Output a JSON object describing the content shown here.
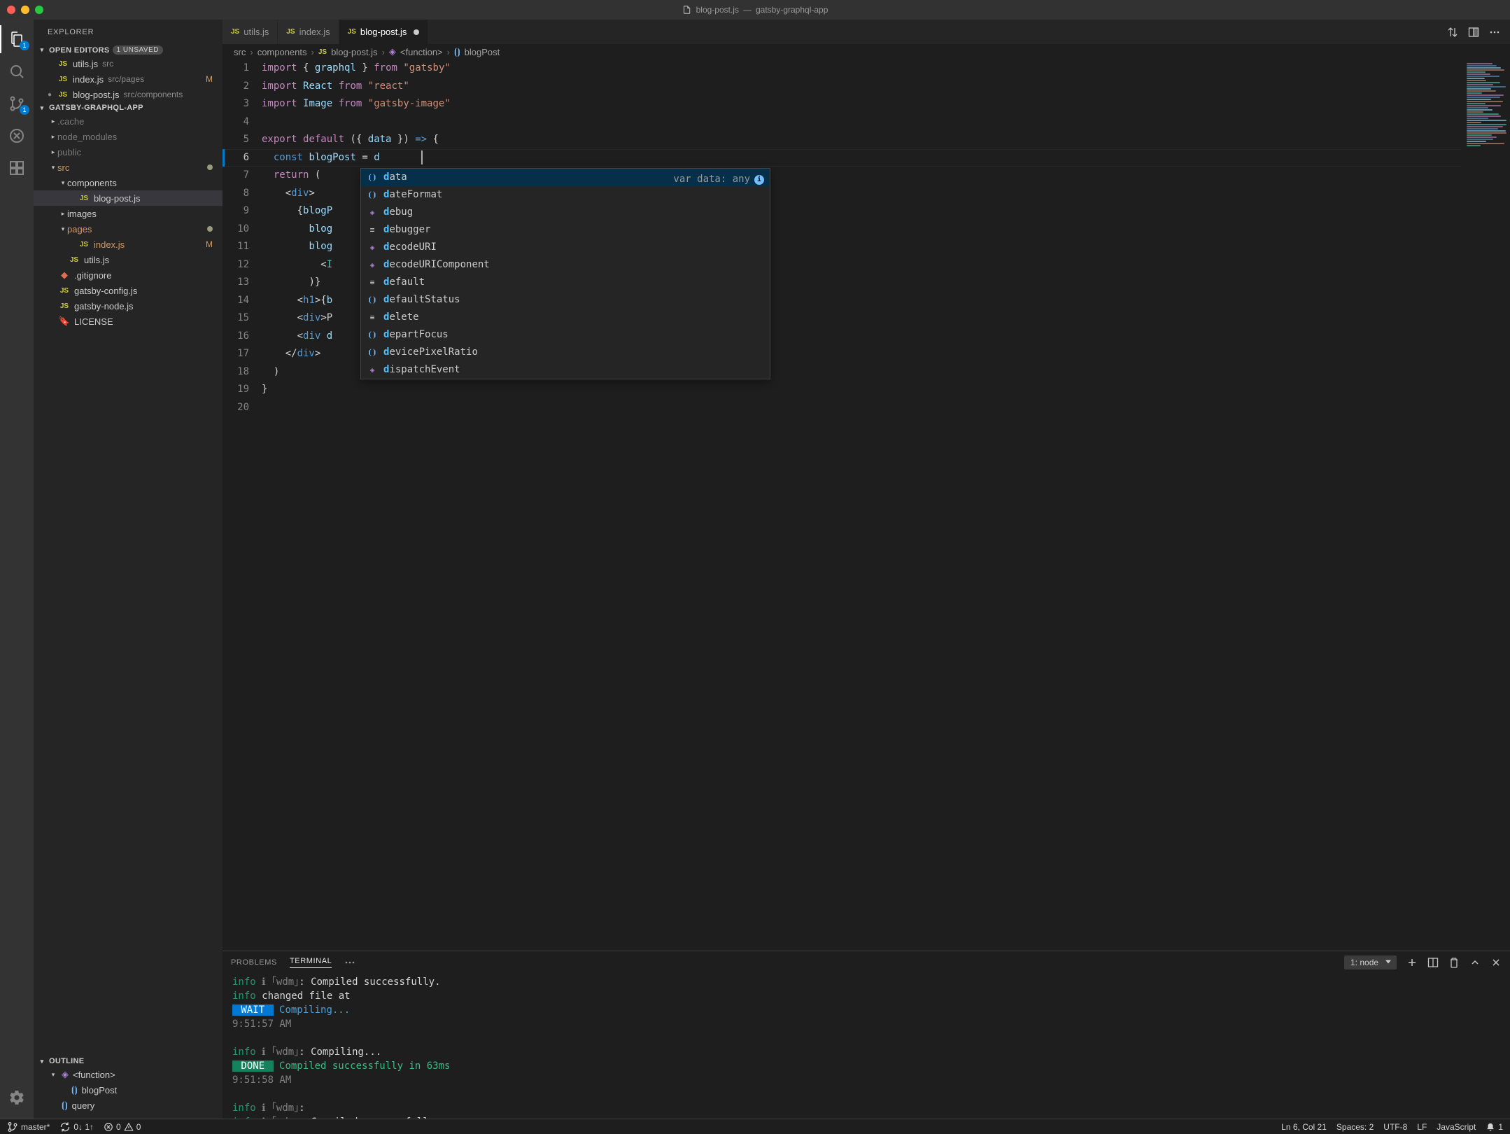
{
  "title": {
    "file": "blog-post.js",
    "project": "gatsby-graphql-app"
  },
  "activity": {
    "explorer_badge": "1",
    "scm_badge": "1"
  },
  "explorer": {
    "title": "EXPLORER",
    "open_editors_label": "OPEN EDITORS",
    "unsaved_badge": "1 UNSAVED",
    "open_editors": [
      {
        "name": "utils.js",
        "path": "src",
        "js": true
      },
      {
        "name": "index.js",
        "path": "src/pages",
        "js": true,
        "git": "M"
      },
      {
        "name": "blog-post.js",
        "path": "src/components",
        "js": true,
        "dirty": true
      }
    ],
    "project_label": "GATSBY-GRAPHQL-APP",
    "tree": [
      {
        "type": "folder",
        "name": ".cache",
        "expanded": false,
        "indent": 1,
        "dim": true
      },
      {
        "type": "folder",
        "name": "node_modules",
        "expanded": false,
        "indent": 1,
        "dim": true
      },
      {
        "type": "folder",
        "name": "public",
        "expanded": false,
        "indent": 1,
        "dim": true
      },
      {
        "type": "folder",
        "name": "src",
        "expanded": true,
        "indent": 1,
        "mod": true,
        "dot": true
      },
      {
        "type": "folder",
        "name": "components",
        "expanded": true,
        "indent": 2
      },
      {
        "type": "file",
        "name": "blog-post.js",
        "js": true,
        "indent": 3,
        "selected": true
      },
      {
        "type": "folder",
        "name": "images",
        "expanded": false,
        "indent": 2
      },
      {
        "type": "folder",
        "name": "pages",
        "expanded": true,
        "indent": 2,
        "mod": true,
        "dot": true
      },
      {
        "type": "file",
        "name": "index.js",
        "js": true,
        "indent": 3,
        "git": "M",
        "mod": true
      },
      {
        "type": "file",
        "name": "utils.js",
        "js": true,
        "indent": 2
      },
      {
        "type": "file",
        "name": ".gitignore",
        "indent": 1,
        "icon": "git"
      },
      {
        "type": "file",
        "name": "gatsby-config.js",
        "js": true,
        "indent": 1
      },
      {
        "type": "file",
        "name": "gatsby-node.js",
        "js": true,
        "indent": 1
      },
      {
        "type": "file",
        "name": "LICENSE",
        "indent": 1,
        "icon": "cert"
      }
    ],
    "outline_label": "OUTLINE",
    "outline": [
      {
        "name": "<function>",
        "icon": "cube",
        "indent": 1,
        "expanded": true
      },
      {
        "name": "blogPost",
        "icon": "brackets",
        "indent": 2
      },
      {
        "name": "query",
        "icon": "brackets",
        "indent": 1
      }
    ]
  },
  "tabs": [
    {
      "name": "utils.js",
      "js": true
    },
    {
      "name": "index.js",
      "js": true
    },
    {
      "name": "blog-post.js",
      "js": true,
      "active": true,
      "dirty": true
    }
  ],
  "breadcrumb": {
    "parts": [
      "src",
      "components"
    ],
    "file": "blog-post.js",
    "symbol1": "<function>",
    "symbol2": "blogPost"
  },
  "code": {
    "lines": [
      {
        "n": 1,
        "html": "<span class='tok-kw'>import</span> <span class='tok-brace'>{</span> <span class='tok-var'>graphql</span> <span class='tok-brace'>}</span> <span class='tok-kw'>from</span> <span class='tok-str'>\"gatsby\"</span>"
      },
      {
        "n": 2,
        "html": "<span class='tok-kw'>import</span> <span class='tok-var'>React</span> <span class='tok-kw'>from</span> <span class='tok-str'>\"react\"</span>"
      },
      {
        "n": 3,
        "html": "<span class='tok-kw'>import</span> <span class='tok-var'>Image</span> <span class='tok-kw'>from</span> <span class='tok-str'>\"gatsby-image\"</span>"
      },
      {
        "n": 4,
        "html": ""
      },
      {
        "n": 5,
        "html": "<span class='tok-kw'>export</span> <span class='tok-kw'>default</span> <span class='tok-punc'>({</span> <span class='tok-var'>data</span> <span class='tok-punc'>})</span> <span class='tok-fn'>=&gt;</span> <span class='tok-punc'>{</span>"
      },
      {
        "n": 6,
        "current": true,
        "html": "  <span class='tok-fn'>const</span> <span class='tok-var'>blogPost</span> <span class='tok-op'>=</span> <span class='tok-var'>d</span>"
      },
      {
        "n": 7,
        "html": "  <span class='tok-kw'>return</span> <span class='tok-punc'>(</span>"
      },
      {
        "n": 8,
        "html": "    <span class='tok-punc'>&lt;</span><span class='tok-tag'>div</span><span class='tok-punc'>&gt;</span>"
      },
      {
        "n": 9,
        "html": "      <span class='tok-punc'>{</span><span class='tok-var'>blogP</span>"
      },
      {
        "n": 10,
        "html": "        <span class='tok-var'>blog</span>"
      },
      {
        "n": 11,
        "html": "        <span class='tok-var'>blog</span>"
      },
      {
        "n": 12,
        "html": "          <span class='tok-punc'>&lt;</span><span class='tok-type'>I</span>"
      },
      {
        "n": 13,
        "html": "        <span class='tok-punc'>)}</span>"
      },
      {
        "n": 14,
        "html": "      <span class='tok-punc'>&lt;</span><span class='tok-tag'>h1</span><span class='tok-punc'>&gt;{</span><span class='tok-var'>b</span>"
      },
      {
        "n": 15,
        "html": "      <span class='tok-punc'>&lt;</span><span class='tok-tag'>div</span><span class='tok-punc'>&gt;</span>P"
      },
      {
        "n": 16,
        "html": "      <span class='tok-punc'>&lt;</span><span class='tok-tag'>div</span> <span class='tok-var'>d</span>"
      },
      {
        "n": 17,
        "html": "    <span class='tok-punc'>&lt;/</span><span class='tok-tag'>div</span><span class='tok-punc'>&gt;</span>"
      },
      {
        "n": 18,
        "html": "  <span class='tok-punc'>)</span>"
      },
      {
        "n": 19,
        "html": "<span class='tok-punc'>}</span>"
      },
      {
        "n": 20,
        "html": ""
      }
    ]
  },
  "suggest": {
    "detail": "var data: any",
    "items": [
      {
        "icon": "var",
        "text": "data",
        "sel": true
      },
      {
        "icon": "var",
        "text": "dateFormat"
      },
      {
        "icon": "fn",
        "text": "debug"
      },
      {
        "icon": "kw",
        "text": "debugger"
      },
      {
        "icon": "fn",
        "text": "decodeURI"
      },
      {
        "icon": "fn",
        "text": "decodeURIComponent"
      },
      {
        "icon": "kw",
        "text": "default"
      },
      {
        "icon": "var",
        "text": "defaultStatus"
      },
      {
        "icon": "kw",
        "text": "delete"
      },
      {
        "icon": "var",
        "text": "departFocus"
      },
      {
        "icon": "var",
        "text": "devicePixelRatio"
      },
      {
        "icon": "fn",
        "text": "dispatchEvent"
      }
    ]
  },
  "panel": {
    "tabs": {
      "problems": "PROBLEMS",
      "terminal": "TERMINAL"
    },
    "select": "1: node",
    "lines": [
      "<span class='t-info'>info</span> <span class='t-dim'>ℹ</span> <span class='t-dim'>｢wdm｣</span><span class='t-text'>: Compiled successfully.</span>",
      "<span class='t-info'>info</span> <span class='t-text'>changed file at</span>",
      "<span class='t-wait'> WAIT </span> <span class='t-wait-txt'>Compiling...</span>",
      "<span class='t-dim'>9:51:57 AM</span>",
      "",
      "<span class='t-info'>info</span> <span class='t-dim'>ℹ</span> <span class='t-dim'>｢wdm｣</span><span class='t-text'>: Compiling...</span>",
      "<span class='t-done'> DONE </span> <span class='t-done-txt'>Compiled successfully in 63ms</span>",
      "<span class='t-dim'>9:51:58 AM</span>",
      "",
      "<span class='t-info'>info</span> <span class='t-dim'>ℹ</span> <span class='t-dim'>｢wdm｣</span><span class='t-text'>:</span>",
      "<span class='t-info'>info</span> <span class='t-dim'>ℹ</span> <span class='t-dim'>｢wdm｣</span><span class='t-text'>: Compiled successfully.</span>"
    ]
  },
  "status": {
    "branch": "master*",
    "sync": "0↓ 1↑",
    "errors": "0",
    "warnings": "0",
    "cursor": "Ln 6, Col 21",
    "spaces": "Spaces: 2",
    "encoding": "UTF-8",
    "eol": "LF",
    "lang": "JavaScript",
    "feedback": "1"
  }
}
